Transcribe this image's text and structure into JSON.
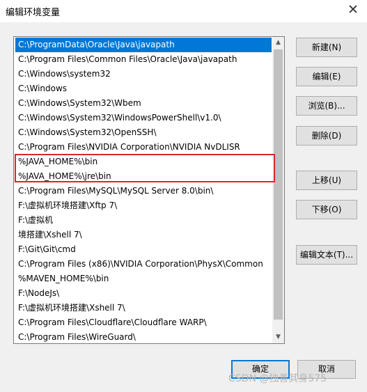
{
  "window": {
    "title": "编辑环境变量",
    "close_glyph": "✕"
  },
  "paths": [
    "C:\\ProgramData\\Oracle\\Java\\javapath",
    "C:\\Program Files\\Common Files\\Oracle\\Java\\javapath",
    "C:\\Windows\\system32",
    "C:\\Windows",
    "C:\\Windows\\System32\\Wbem",
    "C:\\Windows\\System32\\WindowsPowerShell\\v1.0\\",
    "C:\\Windows\\System32\\OpenSSH\\",
    "C:\\Program Files\\NVIDIA Corporation\\NVIDIA NvDLISR",
    "%JAVA_HOME%\\bin",
    "%JAVA_HOME%\\jre\\bin",
    "C:\\Program Files\\MySQL\\MySQL Server 8.0\\bin\\",
    "F:\\虚拟机环境搭建\\Xftp 7\\",
    "F:\\虚拟机",
    "境搭建\\Xshell 7\\",
    "F:\\Git\\Git\\cmd",
    "C:\\Program Files (x86)\\NVIDIA Corporation\\PhysX\\Common",
    "%MAVEN_HOME%\\bin",
    "F:\\NodeJs\\",
    "F:\\虚拟机环境搭建\\Xshell 7\\",
    "C:\\Program Files\\Cloudflare\\Cloudflare WARP\\",
    "C:\\Program Files\\WireGuard\\"
  ],
  "selected_index": 0,
  "buttons": {
    "new": "新建(N)",
    "edit": "编辑(E)",
    "browse": "浏览(B)...",
    "delete": "删除(D)",
    "move_up": "上移(U)",
    "move_down": "下移(O)",
    "edit_text": "编辑文本(T)...",
    "ok": "确定",
    "cancel": "取消"
  },
  "watermark": "CSDN @独善其身575"
}
